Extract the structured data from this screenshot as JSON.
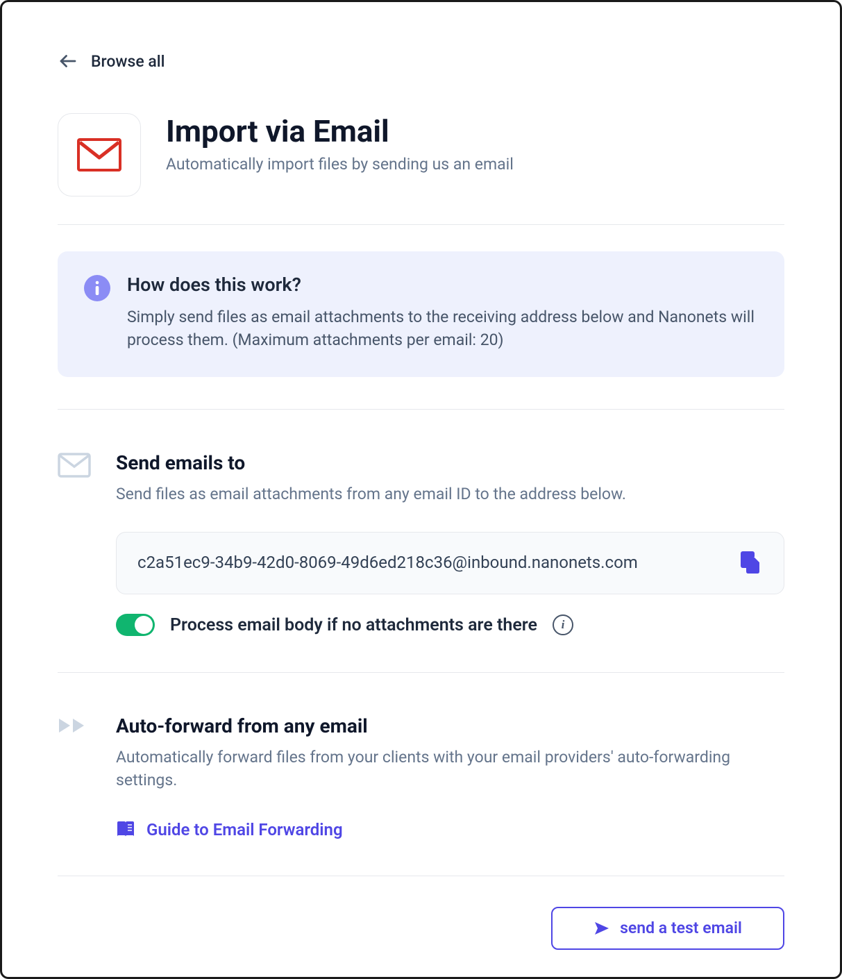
{
  "back": {
    "label": "Browse all"
  },
  "header": {
    "title": "Import via Email",
    "subtitle": "Automatically import files by sending us an email"
  },
  "info": {
    "title": "How does this work?",
    "desc": "Simply send files as email attachments to the receiving address below and Nanonets will process them. (Maximum attachments per email: 20)"
  },
  "send": {
    "title": "Send emails to",
    "desc": "Send files as email attachments from any email ID to the address below.",
    "email": "c2a51ec9-34b9-42d0-8069-49d6ed218c36@inbound.nanonets.com",
    "toggle_label": "Process email body if no attachments are there",
    "toggle_on": true
  },
  "forward": {
    "title": "Auto-forward from any email",
    "desc": "Automatically forward files from your clients with your email providers' auto-forwarding settings.",
    "guide_label": "Guide to Email Forwarding"
  },
  "test_button": {
    "label": "send a test email"
  }
}
